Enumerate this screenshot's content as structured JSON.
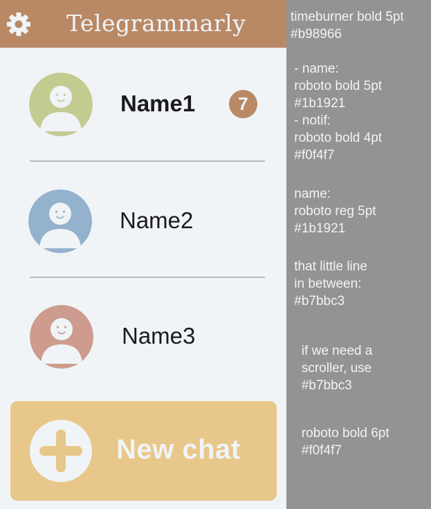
{
  "header": {
    "title": "Telegrammarly",
    "settings_icon": "gear-icon",
    "background_color": "#b98966"
  },
  "chats": [
    {
      "name": "Name1",
      "unread": "7",
      "avatar_color": "#c4cb91",
      "name_weight": "bold"
    },
    {
      "name": "Name2",
      "unread": "",
      "avatar_color": "#94b1cd",
      "name_weight": "regular"
    },
    {
      "name": "Name3",
      "unread": "",
      "avatar_color": "#cd9c8f",
      "name_weight": "regular"
    }
  ],
  "new_chat": {
    "label": "New chat",
    "icon": "plus-icon",
    "background_color": "#e8c78a"
  },
  "notes": [
    "timeburner bold 5pt\n#b98966",
    " - name:\n roboto bold 5pt\n #1b1921\n - notif:\n roboto bold 4pt\n #f0f4f7",
    " name:\n roboto reg 5pt\n #1b1921",
    " that little line\n in between:\n #b7bbc3",
    "   if we need a\n   scroller, use\n   #b7bbc3",
    "   roboto bold 6pt\n   #f0f4f7"
  ],
  "colors": {
    "app_background": "#f0f4f7",
    "text_dark": "#1b1921",
    "divider": "#b7bbc3",
    "notes_background": "#939393"
  }
}
